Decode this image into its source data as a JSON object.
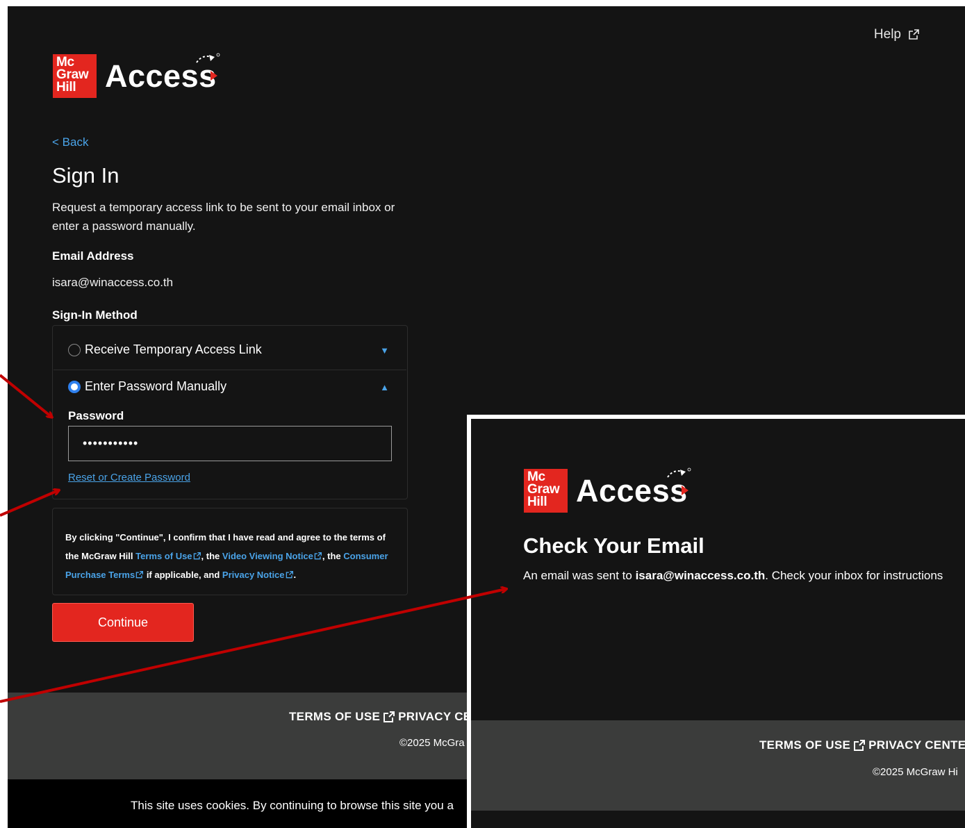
{
  "header": {
    "help_label": "Help"
  },
  "logo": {
    "line1": "Mc",
    "line2": "Graw",
    "line3": "Hill",
    "product": "Access",
    "brand_color": "#e3261f"
  },
  "signin": {
    "back_label": "< Back",
    "title": "Sign In",
    "intro": "Request a temporary access link to be sent to your email inbox or enter a password manually.",
    "email_label": "Email Address",
    "email_value": "isara@winaccess.co.th",
    "method_label": "Sign-In Method",
    "option_link": "Receive Temporary Access Link",
    "option_password": "Enter Password Manually",
    "password_label": "Password",
    "password_value": "•••••••••••",
    "reset_link": "Reset or Create Password",
    "continue_label": "Continue"
  },
  "terms": {
    "p1": "By clicking \"Continue\", I confirm that I have read and agree to the terms of the McGraw Hill ",
    "terms_of_use": "Terms of Use",
    "p2": ", the ",
    "video_notice": "Video Viewing Notice",
    "p3": ", the ",
    "consumer_terms": "Consumer Purchase Terms",
    "p4": " if applicable, and ",
    "privacy_notice": "Privacy Notice",
    "p5": "."
  },
  "footer": {
    "terms_of_use": "TERMS OF USE",
    "privacy_center_partial": "PRIVACY CE",
    "copyright_partial": "©2025 McGra"
  },
  "cookie": {
    "text_partial": "This site uses cookies. By continuing to browse this site you a"
  },
  "overlay": {
    "title": "Check Your Email",
    "msg_before": "An email was sent to ",
    "msg_email": "isara@winaccess.co.th",
    "msg_after": ". Check your inbox for instructions",
    "footer_terms": "TERMS OF USE",
    "footer_privacy_partial": "PRIVACY CENTE",
    "copyright_partial": "©2025 McGraw Hi"
  },
  "colors": {
    "accent": "#4aa3e8",
    "arrow": "#c00000",
    "background": "#141414",
    "footer": "#3b3c3b"
  }
}
